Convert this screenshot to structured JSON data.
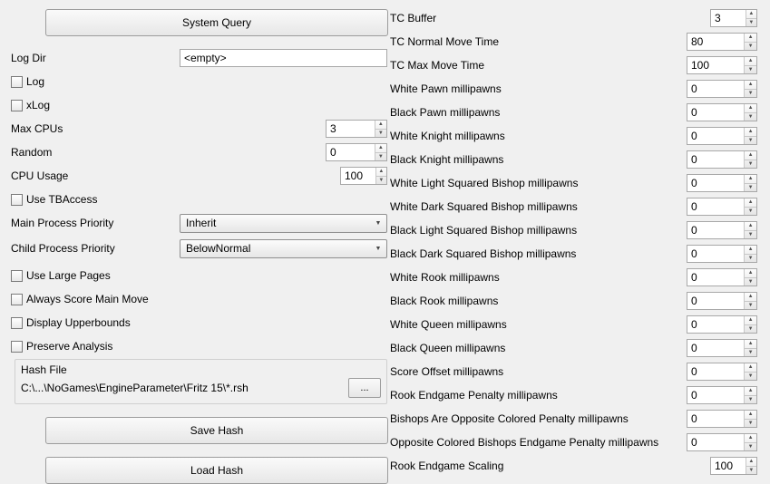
{
  "left": {
    "system_query_btn": "System Query",
    "log_dir_label": "Log Dir",
    "log_dir_value": "<empty>",
    "log_cb_label": "Log",
    "xlog_cb_label": "xLog",
    "max_cpus_label": "Max CPUs",
    "max_cpus_value": "3",
    "random_label": "Random",
    "random_value": "0",
    "cpu_usage_label": "CPU Usage",
    "cpu_usage_value": "100",
    "use_tbaccess_label": "Use TBAccess",
    "main_prio_label": "Main Process Priority",
    "main_prio_value": "Inherit",
    "child_prio_label": "Child Process Priority",
    "child_prio_value": "BelowNormal",
    "use_large_pages_label": "Use Large Pages",
    "always_score_label": "Always Score Main Move",
    "display_upper_label": "Display Upperbounds",
    "preserve_analysis_label": "Preserve Analysis",
    "hash_file_title": "Hash File",
    "hash_file_path": "C:\\...\\NoGames\\EngineParameter\\Fritz 15\\*.rsh",
    "browse_label": "...",
    "save_hash_btn": "Save Hash",
    "load_hash_btn": "Load Hash"
  },
  "right": {
    "items": [
      {
        "label": "TC Buffer",
        "value": "3"
      },
      {
        "label": "TC Normal Move Time",
        "value": "80"
      },
      {
        "label": "TC Max Move Time",
        "value": "100"
      },
      {
        "label": "White Pawn millipawns",
        "value": "0"
      },
      {
        "label": "Black Pawn millipawns",
        "value": "0"
      },
      {
        "label": "White Knight millipawns",
        "value": "0"
      },
      {
        "label": "Black Knight millipawns",
        "value": "0"
      },
      {
        "label": "White Light Squared Bishop millipawns",
        "value": "0"
      },
      {
        "label": "White Dark Squared Bishop millipawns",
        "value": "0"
      },
      {
        "label": "Black Light Squared Bishop millipawns",
        "value": "0"
      },
      {
        "label": "Black Dark Squared Bishop millipawns",
        "value": "0"
      },
      {
        "label": "White Rook millipawns",
        "value": "0"
      },
      {
        "label": "Black Rook millipawns",
        "value": "0"
      },
      {
        "label": "White Queen millipawns",
        "value": "0"
      },
      {
        "label": "Black Queen millipawns",
        "value": "0"
      },
      {
        "label": "Score Offset millipawns",
        "value": "0"
      },
      {
        "label": "Rook Endgame Penalty millipawns",
        "value": "0"
      },
      {
        "label": "Bishops Are Opposite Colored Penalty millipawns",
        "value": "0"
      },
      {
        "label": "Opposite Colored Bishops Endgame Penalty millipawns",
        "value": "0"
      },
      {
        "label": "Rook Endgame Scaling",
        "value": "100"
      }
    ]
  }
}
